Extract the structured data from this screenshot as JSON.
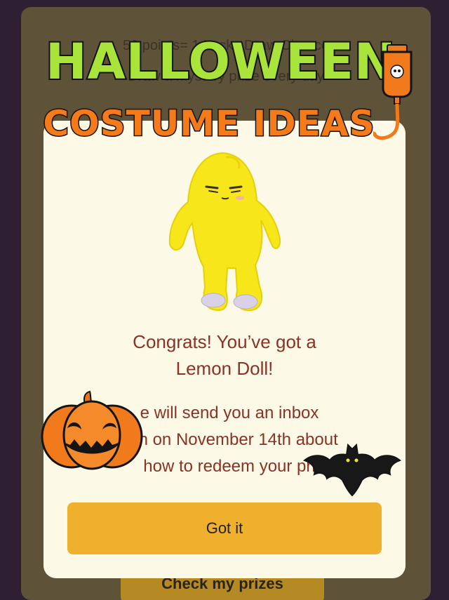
{
  "background_screen": {
    "line1": "50 points= 1 Lucky Draw Chance",
    "line2": "Draw a mystery prize every day",
    "check_prizes_label": "Check my prizes"
  },
  "overlay": {
    "title_line1": "HALLOWEEN",
    "title_line2": "COSTUME IDEAS"
  },
  "modal": {
    "congrats_line1": "Congrats! You’ve got a",
    "congrats_line2": "Lemon Doll!",
    "info_line1": "e will send you an inbox",
    "info_line2": "tion on November 14th about",
    "info_line3": "how to redeem your pri",
    "got_it_label": "Got it"
  },
  "colors": {
    "modal_bg": "#fdf9e7",
    "accent_button": "#efb12d",
    "text_red": "#8b3226",
    "title_green": "#a9e43a",
    "title_orange": "#f57a1a"
  },
  "icons": [
    "lemon-doll-icon",
    "potion-bottle-icon",
    "jack-o-lantern-icon",
    "bat-icon"
  ]
}
